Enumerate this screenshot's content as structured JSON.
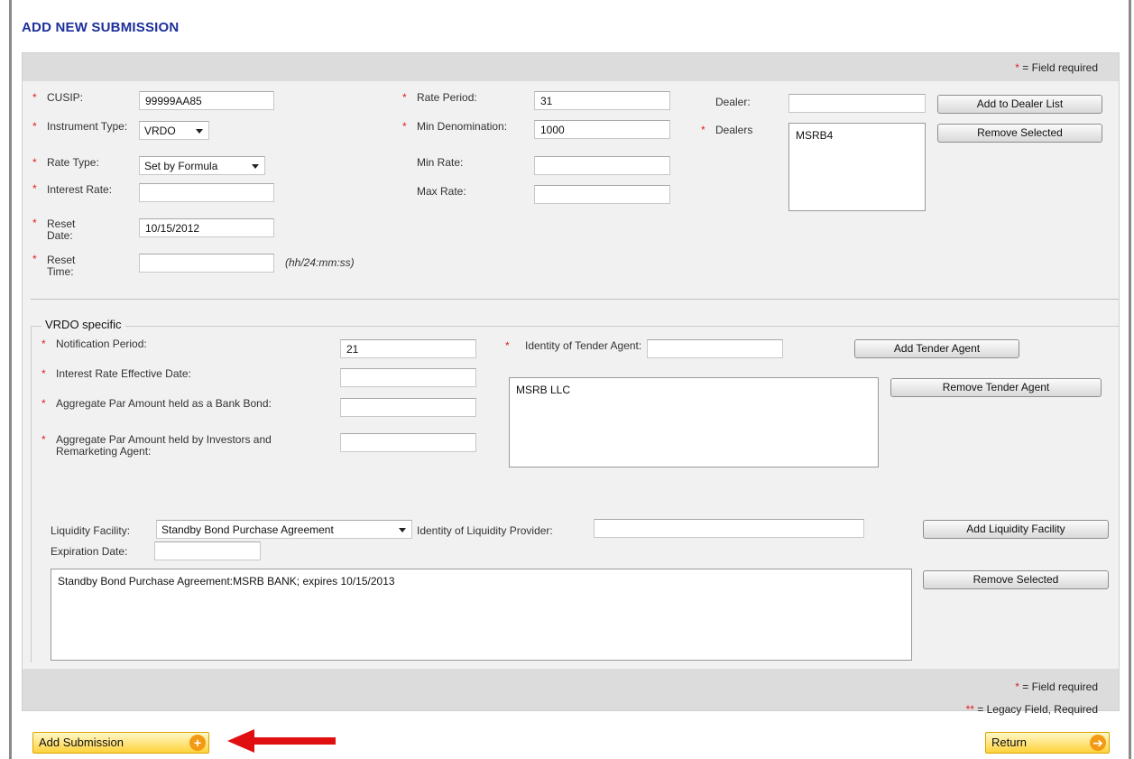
{
  "page": {
    "title": "ADD NEW SUBMISSION"
  },
  "required_note": "= Field required",
  "legacy_note": "= Legacy Field, Required",
  "required_mark": "*",
  "legacy_mark": "**",
  "general": {
    "cusip_label": "CUSIP:",
    "cusip_value": "99999AA85",
    "instrument_label": "Instrument Type:",
    "instrument_value": "VRDO",
    "rate_type_label": "Rate Type:",
    "rate_type_value": "Set by Formula",
    "interest_rate_label": "Interest Rate:",
    "interest_rate_value": "",
    "reset_date_label": "Reset Date:",
    "reset_date_value": "10/15/2012",
    "reset_time_label": "Reset Time:",
    "reset_time_value": "",
    "reset_time_hint": "(hh/24:mm:ss)",
    "rate_period_label": "Rate Period:",
    "rate_period_value": "31",
    "min_denom_label": "Min Denomination:",
    "min_denom_value": "1000",
    "min_rate_label": "Min Rate:",
    "min_rate_value": "",
    "max_rate_label": "Max Rate:",
    "max_rate_value": "",
    "dealer_label": "Dealer:",
    "dealer_value": "",
    "dealers_label": "Dealers",
    "dealers_list": [
      "MSRB4"
    ],
    "add_dealer_btn": "Add to Dealer List",
    "remove_dealer_btn": "Remove Selected"
  },
  "vrdo": {
    "legend": "VRDO specific",
    "notification_label": "Notification Period:",
    "notification_value": "21",
    "ir_effective_label": "Interest Rate Effective Date:",
    "ir_effective_value": "",
    "bank_bond_label": "Aggregate Par Amount held as a Bank Bond:",
    "bank_bond_value": "",
    "investors_label": "Aggregate Par Amount held by Investors and Remarketing Agent:",
    "investors_value": "",
    "tender_label": "Identity of Tender Agent:",
    "tender_value": "",
    "tender_list": [
      "MSRB LLC"
    ],
    "add_tender_btn": "Add Tender Agent",
    "remove_tender_btn": "Remove Tender Agent",
    "liquidity_label": "Liquidity Facility:",
    "liquidity_value": "Standby Bond Purchase Agreement",
    "provider_label": "Identity of Liquidity Provider:",
    "provider_value": "",
    "expiration_label": "Expiration Date:",
    "expiration_value": "",
    "add_liquidity_btn": "Add Liquidity Facility",
    "remove_liquidity_btn": "Remove Selected",
    "liquidity_list": [
      "Standby Bond Purchase Agreement:MSRB BANK; expires 10/15/2013"
    ]
  },
  "footer": {
    "add_submission_btn": "Add Submission",
    "return_btn": "Return"
  },
  "colors": {
    "title": "#1c2f9a",
    "required": "#e02020",
    "accent_orange": "#f29a14",
    "arrow": "#e01010"
  }
}
